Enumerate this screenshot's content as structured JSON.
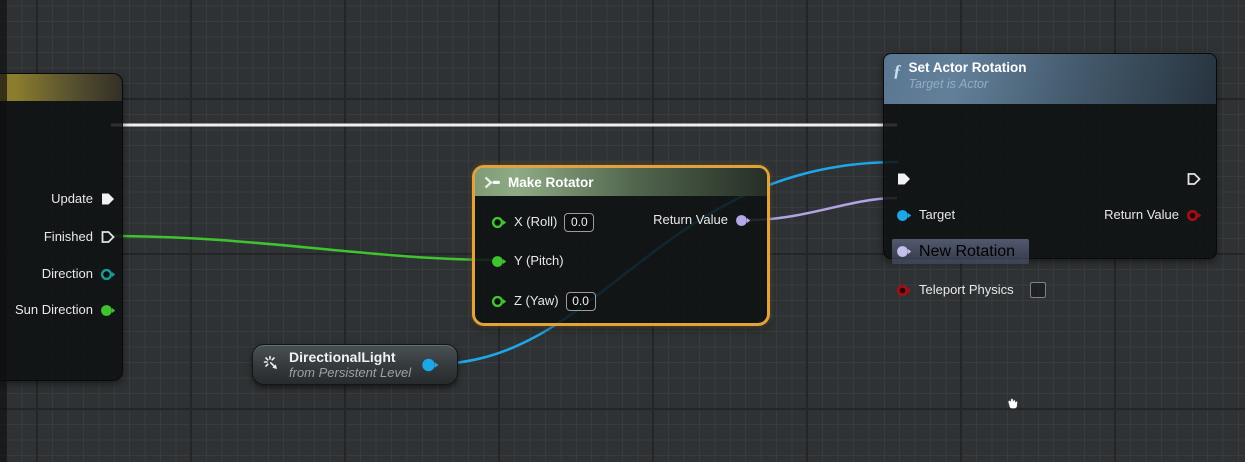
{
  "timeline_node": {
    "pins": [
      {
        "label": "Update"
      },
      {
        "label": "Finished"
      },
      {
        "label": "Direction"
      },
      {
        "label": "Sun Direction"
      }
    ]
  },
  "make_rotator_node": {
    "title": "Make Rotator",
    "inputs": [
      {
        "label": "X (Roll)",
        "value": "0.0"
      },
      {
        "label": "Y (Pitch)"
      },
      {
        "label": "Z (Yaw)",
        "value": "0.0"
      }
    ],
    "output_label": "Return Value"
  },
  "set_actor_rotation_node": {
    "fn_glyph": "ƒ",
    "title": "Set Actor Rotation",
    "subtitle": "Target is Actor",
    "inputs": [
      {
        "label": "Target"
      },
      {
        "label": "New Rotation"
      },
      {
        "label": "Teleport Physics"
      }
    ],
    "output_label": "Return Value"
  },
  "directional_light_node": {
    "title": "DirectionalLight",
    "subtitle": "from Persistent Level"
  },
  "colors": {
    "exec_wire": "#f0f0f0",
    "float_pin": "#3fc42f",
    "enum_pin": "#189a94",
    "object_pin": "#1ea7e8",
    "rotator_pin": "#b7a9e8",
    "bool_pin": "#9d1018",
    "selection_border": "#e2a33c"
  }
}
